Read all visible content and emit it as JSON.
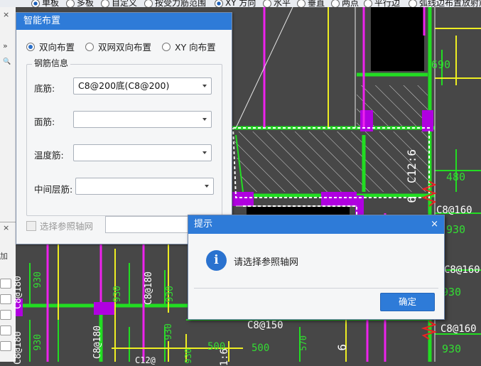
{
  "top_options": [
    {
      "label": "单板",
      "checked": true
    },
    {
      "label": "多板",
      "checked": false
    },
    {
      "label": "自定义",
      "checked": false
    },
    {
      "label": "按受力筋范围",
      "checked": false
    },
    {
      "label": "XY 方向",
      "checked": true
    },
    {
      "label": "水平",
      "checked": false
    },
    {
      "label": "垂直",
      "checked": false
    },
    {
      "label": "两点",
      "checked": false
    },
    {
      "label": "平行边",
      "checked": false
    },
    {
      "label": "弧线边布置放射筋",
      "checked": false
    }
  ],
  "side": {
    "close": "×",
    "arrows": "»",
    "search": "🔍",
    "close2": "×",
    "cut_text": "加"
  },
  "cad_labels": {
    "t1": "690",
    "t2": "480",
    "t3": "C8@160",
    "t4": "930",
    "t5": "C8@160",
    "t6": "930",
    "t7": "C8@160",
    "t8": "930",
    "t9": "C8@150",
    "t10": "500",
    "t11": "500",
    "t12": "570",
    "t13": "C8@180",
    "t14": "930",
    "t15": "C8@180",
    "t16": "930",
    "t17": "930",
    "t18": "C8@180",
    "t19": "930",
    "t20": "C8@180",
    "t21": "930",
    "t22": "C12@",
    "t23": "930",
    "t24": "1:6",
    "t25": "6",
    "t26": "C12:6",
    "t27": "6"
  },
  "panel": {
    "title": "智能布置",
    "layout_options": [
      {
        "label": "双向布置",
        "checked": true
      },
      {
        "label": "双网双向布置",
        "checked": false
      },
      {
        "label": "XY 向布置",
        "checked": false
      }
    ],
    "group_title": "钢筋信息",
    "fields": [
      {
        "label": "底筋:",
        "value": "C8@200底(C8@200)"
      },
      {
        "label": "面筋:",
        "value": ""
      },
      {
        "label": "温度筋:",
        "value": ""
      },
      {
        "label": "中间层筋:",
        "value": ""
      }
    ],
    "axis_checkbox": "选择参照轴网"
  },
  "dialog": {
    "title": "提示",
    "close": "×",
    "icon": "i",
    "message": "请选择参照轴网",
    "ok": "确定"
  }
}
